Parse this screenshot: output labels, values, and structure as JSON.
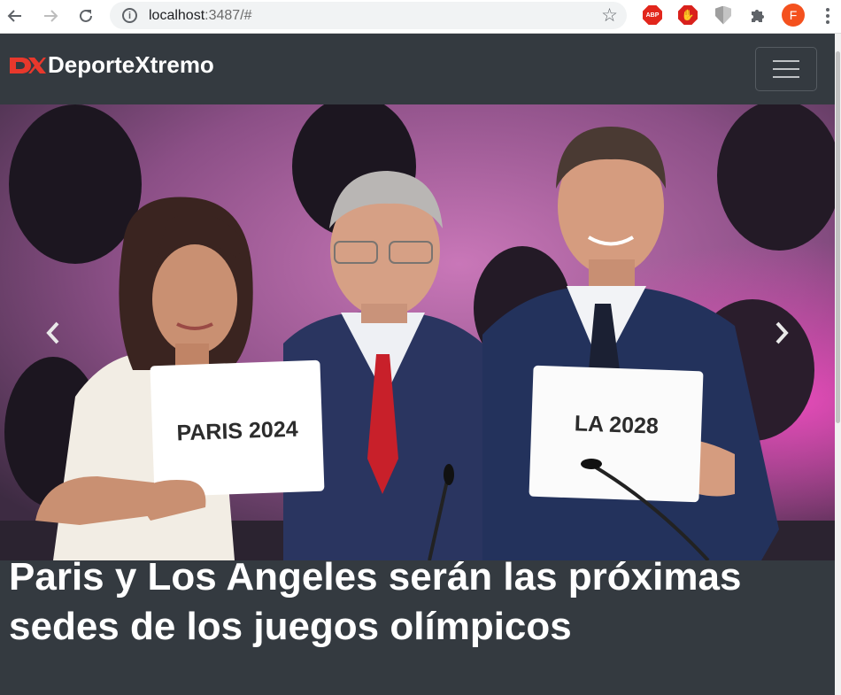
{
  "browser": {
    "url_host": "localhost",
    "url_rest": ":3487/#",
    "extensions": {
      "abp_label": "ABP",
      "profile_initial": "F"
    }
  },
  "navbar": {
    "brand_name": "DeporteXtremo"
  },
  "carousel": {
    "slide": {
      "sign_left": "PARIS 2024",
      "sign_right": "LA 2028"
    }
  },
  "article": {
    "headline": "Paris y Los Angeles serán las próximas sedes de los juegos olímpicos"
  },
  "colors": {
    "navbar_bg": "#343a40",
    "brand_accent": "#e8382c",
    "text": "#ffffff"
  }
}
